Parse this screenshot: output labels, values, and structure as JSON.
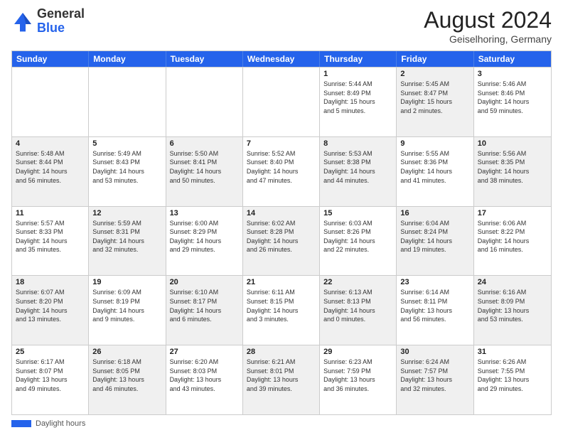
{
  "header": {
    "logo_general": "General",
    "logo_blue": "Blue",
    "month_year": "August 2024",
    "location": "Geiselhoring, Germany"
  },
  "weekdays": [
    "Sunday",
    "Monday",
    "Tuesday",
    "Wednesday",
    "Thursday",
    "Friday",
    "Saturday"
  ],
  "footer": {
    "legend_label": "Daylight hours"
  },
  "weeks": [
    [
      {
        "day": "",
        "info": "",
        "shaded": false
      },
      {
        "day": "",
        "info": "",
        "shaded": false
      },
      {
        "day": "",
        "info": "",
        "shaded": false
      },
      {
        "day": "",
        "info": "",
        "shaded": false
      },
      {
        "day": "1",
        "info": "Sunrise: 5:44 AM\nSunset: 8:49 PM\nDaylight: 15 hours\nand 5 minutes.",
        "shaded": false
      },
      {
        "day": "2",
        "info": "Sunrise: 5:45 AM\nSunset: 8:47 PM\nDaylight: 15 hours\nand 2 minutes.",
        "shaded": true
      },
      {
        "day": "3",
        "info": "Sunrise: 5:46 AM\nSunset: 8:46 PM\nDaylight: 14 hours\nand 59 minutes.",
        "shaded": false
      }
    ],
    [
      {
        "day": "4",
        "info": "Sunrise: 5:48 AM\nSunset: 8:44 PM\nDaylight: 14 hours\nand 56 minutes.",
        "shaded": true
      },
      {
        "day": "5",
        "info": "Sunrise: 5:49 AM\nSunset: 8:43 PM\nDaylight: 14 hours\nand 53 minutes.",
        "shaded": false
      },
      {
        "day": "6",
        "info": "Sunrise: 5:50 AM\nSunset: 8:41 PM\nDaylight: 14 hours\nand 50 minutes.",
        "shaded": true
      },
      {
        "day": "7",
        "info": "Sunrise: 5:52 AM\nSunset: 8:40 PM\nDaylight: 14 hours\nand 47 minutes.",
        "shaded": false
      },
      {
        "day": "8",
        "info": "Sunrise: 5:53 AM\nSunset: 8:38 PM\nDaylight: 14 hours\nand 44 minutes.",
        "shaded": true
      },
      {
        "day": "9",
        "info": "Sunrise: 5:55 AM\nSunset: 8:36 PM\nDaylight: 14 hours\nand 41 minutes.",
        "shaded": false
      },
      {
        "day": "10",
        "info": "Sunrise: 5:56 AM\nSunset: 8:35 PM\nDaylight: 14 hours\nand 38 minutes.",
        "shaded": true
      }
    ],
    [
      {
        "day": "11",
        "info": "Sunrise: 5:57 AM\nSunset: 8:33 PM\nDaylight: 14 hours\nand 35 minutes.",
        "shaded": false
      },
      {
        "day": "12",
        "info": "Sunrise: 5:59 AM\nSunset: 8:31 PM\nDaylight: 14 hours\nand 32 minutes.",
        "shaded": true
      },
      {
        "day": "13",
        "info": "Sunrise: 6:00 AM\nSunset: 8:29 PM\nDaylight: 14 hours\nand 29 minutes.",
        "shaded": false
      },
      {
        "day": "14",
        "info": "Sunrise: 6:02 AM\nSunset: 8:28 PM\nDaylight: 14 hours\nand 26 minutes.",
        "shaded": true
      },
      {
        "day": "15",
        "info": "Sunrise: 6:03 AM\nSunset: 8:26 PM\nDaylight: 14 hours\nand 22 minutes.",
        "shaded": false
      },
      {
        "day": "16",
        "info": "Sunrise: 6:04 AM\nSunset: 8:24 PM\nDaylight: 14 hours\nand 19 minutes.",
        "shaded": true
      },
      {
        "day": "17",
        "info": "Sunrise: 6:06 AM\nSunset: 8:22 PM\nDaylight: 14 hours\nand 16 minutes.",
        "shaded": false
      }
    ],
    [
      {
        "day": "18",
        "info": "Sunrise: 6:07 AM\nSunset: 8:20 PM\nDaylight: 14 hours\nand 13 minutes.",
        "shaded": true
      },
      {
        "day": "19",
        "info": "Sunrise: 6:09 AM\nSunset: 8:19 PM\nDaylight: 14 hours\nand 9 minutes.",
        "shaded": false
      },
      {
        "day": "20",
        "info": "Sunrise: 6:10 AM\nSunset: 8:17 PM\nDaylight: 14 hours\nand 6 minutes.",
        "shaded": true
      },
      {
        "day": "21",
        "info": "Sunrise: 6:11 AM\nSunset: 8:15 PM\nDaylight: 14 hours\nand 3 minutes.",
        "shaded": false
      },
      {
        "day": "22",
        "info": "Sunrise: 6:13 AM\nSunset: 8:13 PM\nDaylight: 14 hours\nand 0 minutes.",
        "shaded": true
      },
      {
        "day": "23",
        "info": "Sunrise: 6:14 AM\nSunset: 8:11 PM\nDaylight: 13 hours\nand 56 minutes.",
        "shaded": false
      },
      {
        "day": "24",
        "info": "Sunrise: 6:16 AM\nSunset: 8:09 PM\nDaylight: 13 hours\nand 53 minutes.",
        "shaded": true
      }
    ],
    [
      {
        "day": "25",
        "info": "Sunrise: 6:17 AM\nSunset: 8:07 PM\nDaylight: 13 hours\nand 49 minutes.",
        "shaded": false
      },
      {
        "day": "26",
        "info": "Sunrise: 6:18 AM\nSunset: 8:05 PM\nDaylight: 13 hours\nand 46 minutes.",
        "shaded": true
      },
      {
        "day": "27",
        "info": "Sunrise: 6:20 AM\nSunset: 8:03 PM\nDaylight: 13 hours\nand 43 minutes.",
        "shaded": false
      },
      {
        "day": "28",
        "info": "Sunrise: 6:21 AM\nSunset: 8:01 PM\nDaylight: 13 hours\nand 39 minutes.",
        "shaded": true
      },
      {
        "day": "29",
        "info": "Sunrise: 6:23 AM\nSunset: 7:59 PM\nDaylight: 13 hours\nand 36 minutes.",
        "shaded": false
      },
      {
        "day": "30",
        "info": "Sunrise: 6:24 AM\nSunset: 7:57 PM\nDaylight: 13 hours\nand 32 minutes.",
        "shaded": true
      },
      {
        "day": "31",
        "info": "Sunrise: 6:26 AM\nSunset: 7:55 PM\nDaylight: 13 hours\nand 29 minutes.",
        "shaded": false
      }
    ]
  ]
}
